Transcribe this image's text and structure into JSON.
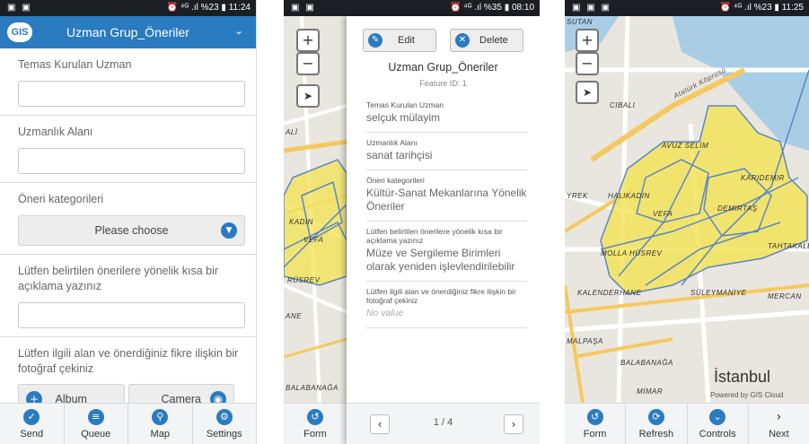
{
  "status1": {
    "left": "▣ ▣",
    "right": "⏰ ⁴ᴳ .ıl %23 ▮ 11:24"
  },
  "status2": {
    "left": "▣ ▣",
    "right": "⏰ ⁴ᴳ .ıl %35 ▮ 08:10"
  },
  "status3": {
    "left": "▣ ▣ ▣",
    "right": "⏰ ⁴ᴳ .ıl %23 ▮ 11:25"
  },
  "header": {
    "logo": "GIS",
    "title": "Uzman Grup_Öneriler"
  },
  "form": {
    "f1_label": "Temas Kurulan Uzman",
    "f2_label": "Uzmanlık Alanı",
    "f3_label": "Öneri kategorileri",
    "f3_select": "Please choose",
    "f4_label": "Lütfen belirtilen önerilere yönelik kısa bir açıklama yazınız",
    "f5_label": "Lütfen ilgili alan ve önerdiğiniz fikre ilişkin bir fotoğraf çekiniz",
    "album": "Album",
    "camera": "Camera"
  },
  "tabs1": [
    {
      "label": "Send",
      "icon": "check-icon"
    },
    {
      "label": "Queue",
      "icon": "list-icon"
    },
    {
      "label": "Map",
      "icon": "map-pin-icon"
    },
    {
      "label": "Settings",
      "icon": "gear-icon"
    }
  ],
  "popup": {
    "edit": "Edit",
    "delete": "Delete",
    "title": "Uzman Grup_Öneriler",
    "feature_id": "Feature ID: 1",
    "attrs": [
      {
        "k": "Temas Kurulan Uzman",
        "v": "selçuk mülayim"
      },
      {
        "k": "Uzmanlık Alanı",
        "v": "sanat tarihçisi"
      },
      {
        "k": "Öneri kategorileri",
        "v": "Kültür-Sanat Mekanlarına Yönelik Öneriler"
      },
      {
        "k": "Lütfen belirtilen önerilere yönelik kısa bir açıklama yazınız",
        "v": "Müze ve Sergileme Birimleri olarak yeniden işlevlendirilebilir"
      },
      {
        "k": "Lütfen ilgili alan ve önerdiğiniz fikre ilişkin bir fotoğraf çekiniz",
        "v": "No value"
      }
    ],
    "page": "1 / 4",
    "form_tab": "Form"
  },
  "map2": {
    "labels": [
      "ALİ",
      "KADIN",
      "VEFA",
      "RÜSREV",
      "ANE",
      "BALABANAĞA"
    ]
  },
  "map3": {
    "labels": [
      "SUTAN",
      "CIBALI",
      "Atatürk Köprüsü",
      "AVUZ SELİM",
      "HALIKADIN",
      "VEFA",
      "KARIDEMIR",
      "DEMIRTAŞ",
      "MOLLA HÜSREV",
      "KALENDERHANE",
      "SÜLEYMANİYE",
      "MERCAN",
      "TAHTAKALE",
      "MALPAŞA",
      "BALABANAĞA",
      "MİMAR",
      "YREK"
    ],
    "city": "İstanbul",
    "credit": "Powered by GIS Cloud"
  },
  "tabs3": [
    {
      "label": "Form",
      "icon": "undo-icon"
    },
    {
      "label": "Refresh",
      "icon": "refresh-icon"
    },
    {
      "label": "Controls",
      "icon": "chevron-down-icon"
    },
    {
      "label": "Next",
      "icon": "chevron-right-icon"
    }
  ],
  "colors": {
    "accent": "#2a7bc0",
    "polygon_fill": "#f2e35a",
    "polygon_stroke": "#5b86c9",
    "water": "#a9cde5",
    "road": "#f5c95f"
  }
}
